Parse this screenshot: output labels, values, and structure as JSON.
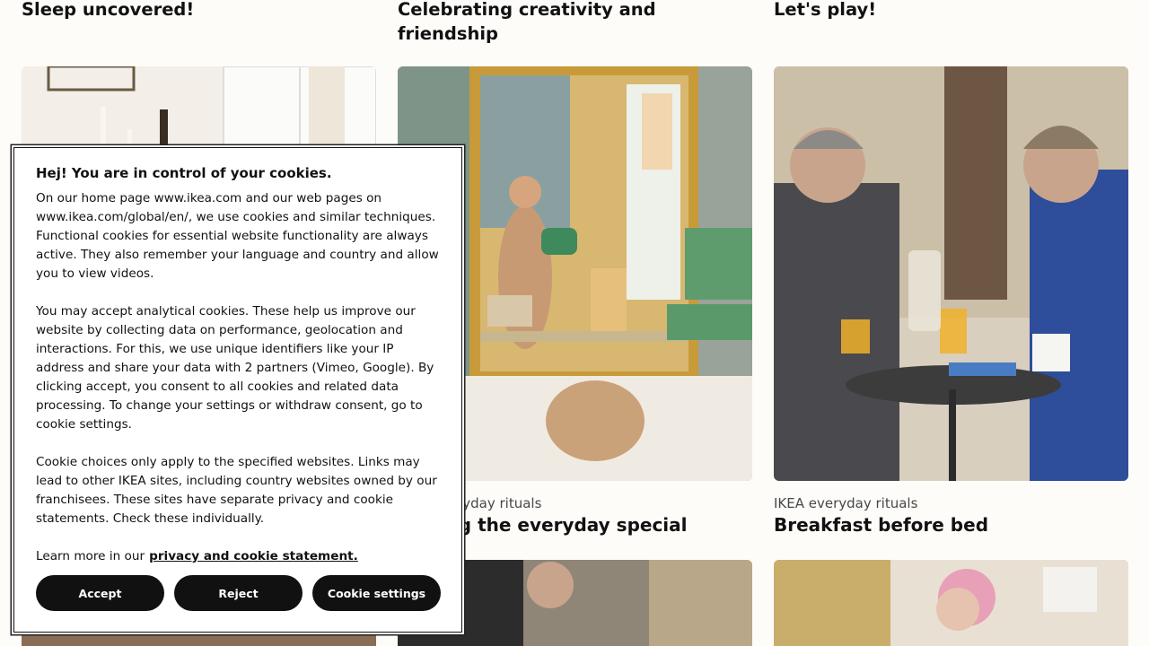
{
  "cards": [
    {
      "headline": "Sleep uncovered!",
      "category": "",
      "title": ""
    },
    {
      "headline": "Celebrating creativity and friendship",
      "category": "IKEA everyday rituals",
      "title": "Making the everyday special"
    },
    {
      "headline": "Let's play!",
      "category": "IKEA everyday rituals",
      "title": "Breakfast before bed"
    }
  ],
  "cookie": {
    "title": "Hej! You are in control of your cookies.",
    "para1": "On our home page www.ikea.com and our web pages on www.ikea.com/global/en/, we use cookies and similar techniques. Functional cookies for essential website functionality are always active. They also remember your language and country and allow you to view videos.",
    "para2": "You may accept analytical cookies. These help us improve our website by collecting data on performance, geolocation and interactions. For this, we use unique identifiers like your IP address and share your data with 2 partners (Vimeo, Google). By clicking accept, you consent to all cookies and related data processing. To change your settings or withdraw consent, go to cookie settings.",
    "para3": "Cookie choices only apply to the specified websites. Links may lead to other IKEA sites, including country websites owned by our franchisees. These sites have separate privacy and cookie statements. Check these individually.",
    "learn_more_prefix": "Learn more in our",
    "learn_more_link": "privacy and cookie statement.",
    "accept_label": "Accept",
    "reject_label": "Reject",
    "settings_label": "Cookie settings"
  }
}
